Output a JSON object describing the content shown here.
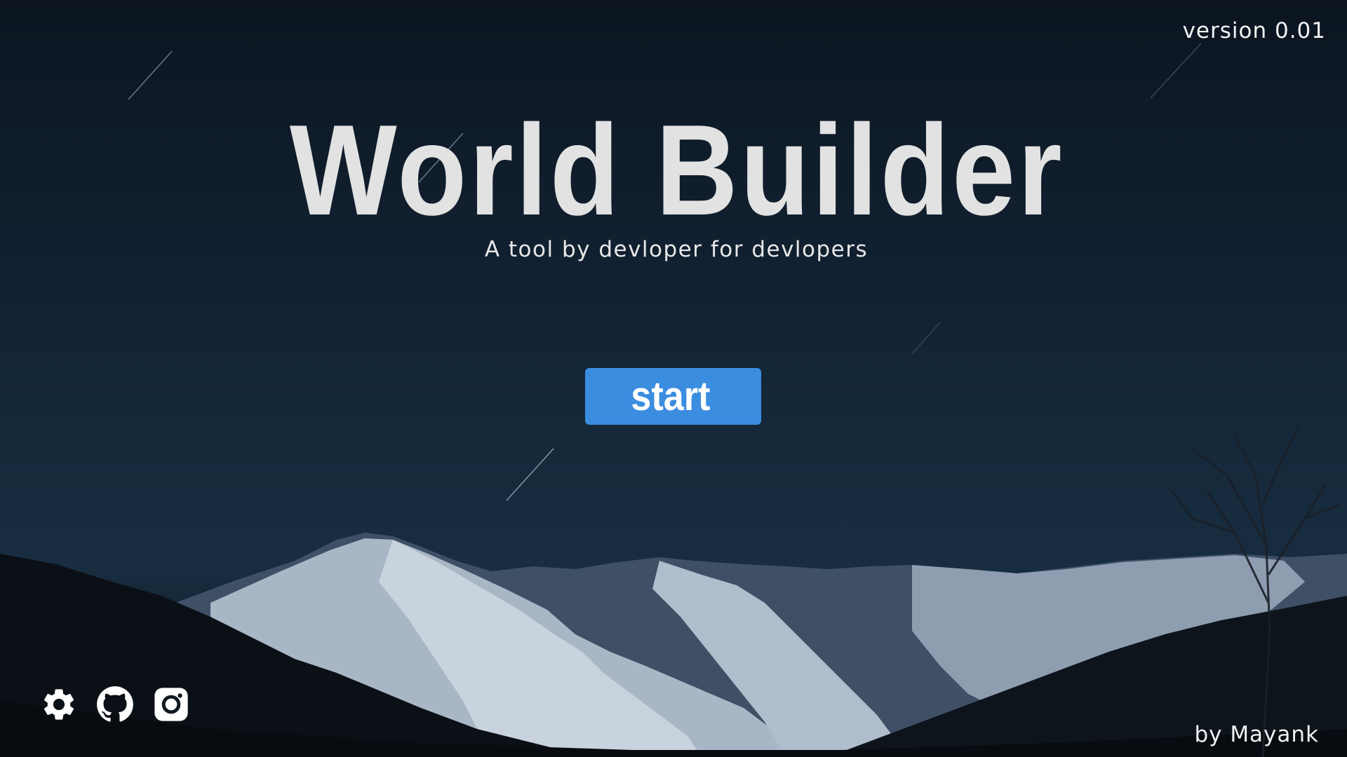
{
  "header": {
    "version_label": "version 0.01"
  },
  "hero": {
    "title": "World Builder",
    "subtitle": "A tool by devloper for devlopers"
  },
  "actions": {
    "start_label": "start"
  },
  "social": {
    "icons": [
      "gear-icon",
      "github-icon",
      "instagram-icon"
    ]
  },
  "footer": {
    "credit": "by Mayank"
  },
  "colors": {
    "accent": "#3b8de0",
    "title_text": "#e2e2e2",
    "sky_dark": "#0c1520",
    "sky_mid": "#15293b"
  }
}
